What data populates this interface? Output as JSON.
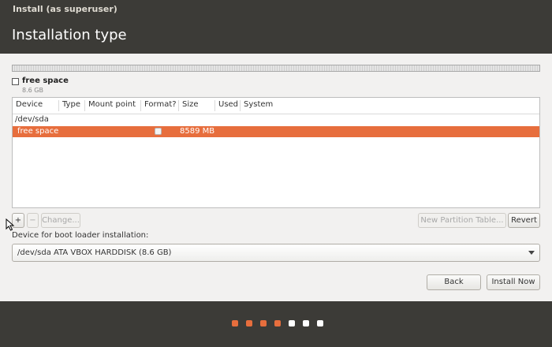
{
  "window": {
    "title": "Install (as superuser)"
  },
  "page": {
    "title": "Installation type"
  },
  "disk": {
    "legend_label": "free space",
    "legend_size": "8.6 GB"
  },
  "table": {
    "columns": [
      "Device",
      "Type",
      "Mount point",
      "Format?",
      "Size",
      "Used",
      "System"
    ],
    "device_row": "/dev/sda",
    "selected_row": {
      "device": "free space",
      "format_checked": false,
      "size": "8589 MB"
    }
  },
  "toolbar": {
    "add_label": "+",
    "remove_label": "−",
    "change_label": "Change...",
    "new_table_label": "New Partition Table...",
    "revert_label": "Revert"
  },
  "boot_loader": {
    "label": "Device for boot loader installation:",
    "selected": "/dev/sda ATA VBOX HARDDISK (8.6 GB)"
  },
  "actions": {
    "back_label": "Back",
    "install_label": "Install Now"
  },
  "progress": {
    "total_steps": 7,
    "completed_steps": 4
  },
  "colors": {
    "accent": "#e76e3d",
    "dark_bg": "#3c3b37",
    "dot_done": "#e76e3d",
    "dot_todo": "#ffffff"
  }
}
